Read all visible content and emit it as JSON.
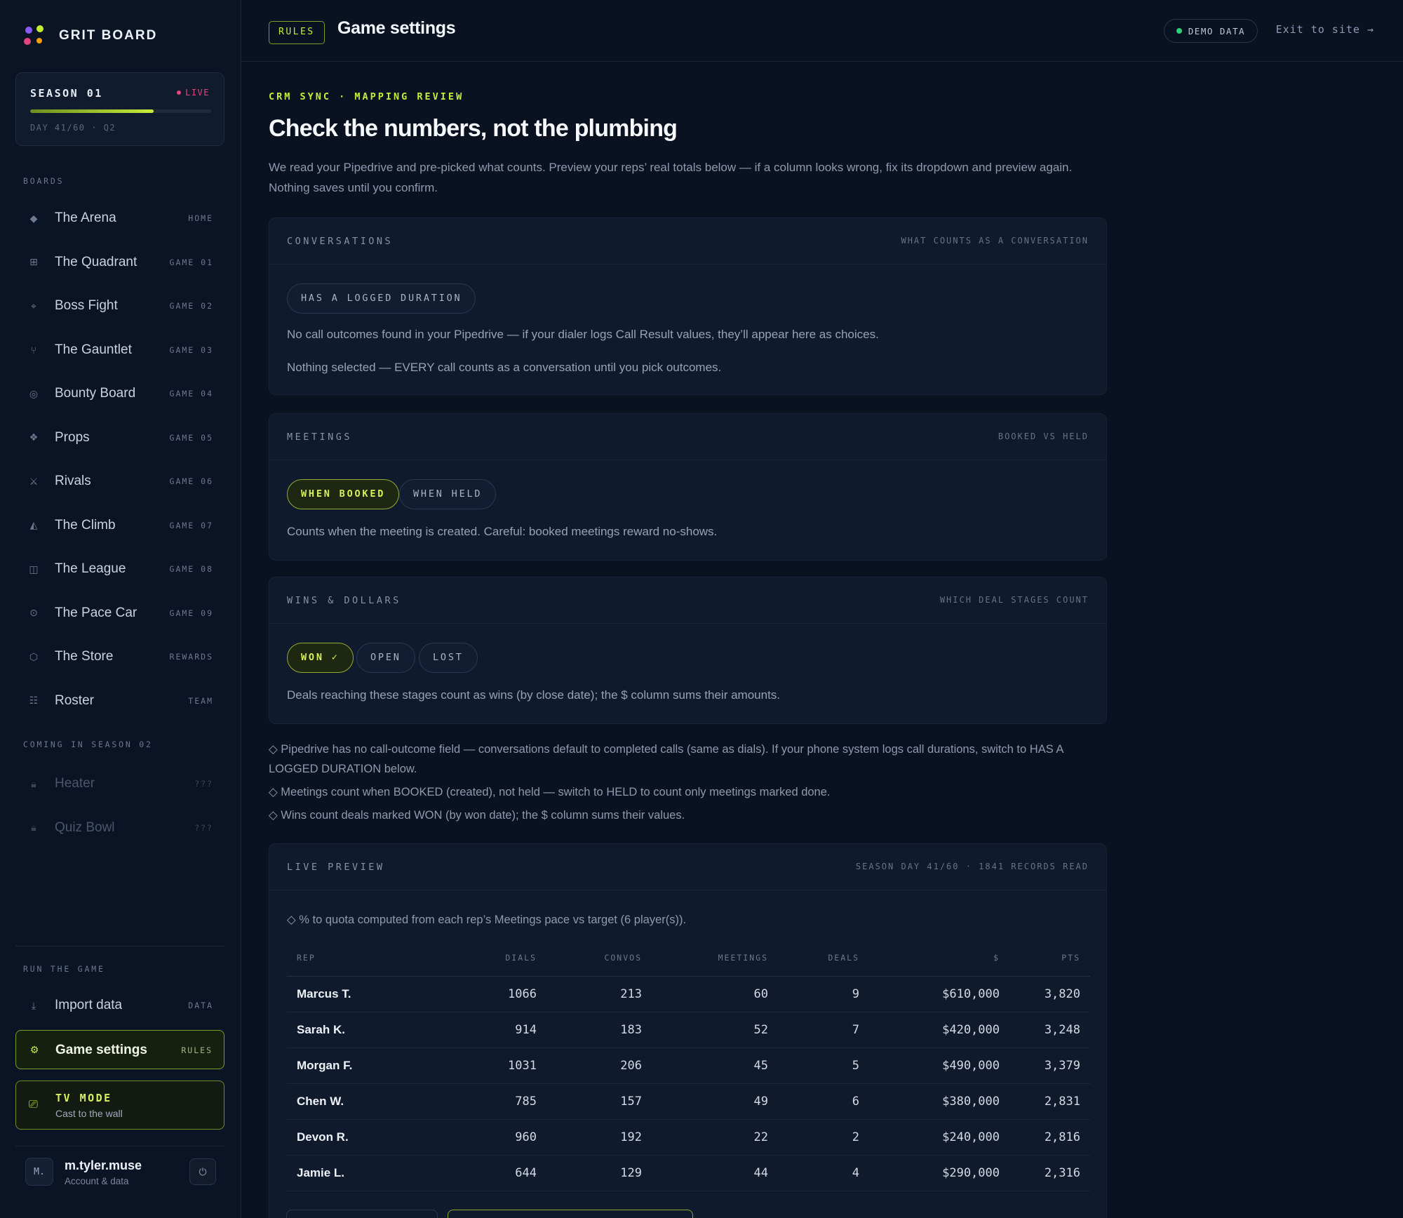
{
  "brand": {
    "name": "GRIT BOARD",
    "colors": [
      "#8a5cf6",
      "#c6ec3a",
      "#e5457d",
      "#f59e0b"
    ]
  },
  "season": {
    "title": "SEASON 01",
    "status": "LIVE",
    "progress": 0.6833,
    "day": "DAY 41/60 · Q2"
  },
  "sidebar": {
    "boards_label": "BOARDS",
    "boards": [
      {
        "icon": "diamond-icon",
        "glyph": "◆",
        "label": "The Arena",
        "tag": "HOME"
      },
      {
        "icon": "grid-icon",
        "glyph": "⊞",
        "label": "The Quadrant",
        "tag": "GAME 01"
      },
      {
        "icon": "crosshair-icon",
        "glyph": "⌖",
        "label": "Boss Fight",
        "tag": "GAME 02"
      },
      {
        "icon": "fork-icon",
        "glyph": "⑂",
        "label": "The Gauntlet",
        "tag": "GAME 03"
      },
      {
        "icon": "target-icon",
        "glyph": "◎",
        "label": "Bounty Board",
        "tag": "GAME 04"
      },
      {
        "icon": "sparkle-icon",
        "glyph": "❖",
        "label": "Props",
        "tag": "GAME 05"
      },
      {
        "icon": "swords-icon",
        "glyph": "⚔",
        "label": "Rivals",
        "tag": "GAME 06"
      },
      {
        "icon": "mountain-icon",
        "glyph": "◭",
        "label": "The Climb",
        "tag": "GAME 07"
      },
      {
        "icon": "columns-icon",
        "glyph": "◫",
        "label": "The League",
        "tag": "GAME 08"
      },
      {
        "icon": "gauge-icon",
        "glyph": "⊙",
        "label": "The Pace Car",
        "tag": "GAME 09"
      },
      {
        "icon": "hexagon-icon",
        "glyph": "⬡",
        "label": "The Store",
        "tag": "REWARDS"
      },
      {
        "icon": "list-icon",
        "glyph": "☷",
        "label": "Roster",
        "tag": "TEAM"
      }
    ],
    "coming_label": "COMING IN SEASON 02",
    "coming": [
      {
        "icon": "lock-icon",
        "glyph": "🔒︎",
        "label": "Heater",
        "tag": "???"
      },
      {
        "icon": "lock-icon",
        "glyph": "🔒︎",
        "label": "Quiz Bowl",
        "tag": "???"
      }
    ],
    "run_label": "RUN THE GAME",
    "run": [
      {
        "icon": "download-icon",
        "glyph": "⤓",
        "label": "Import data",
        "tag": "DATA"
      },
      {
        "icon": "gear-icon",
        "glyph": "⚙",
        "label": "Game settings",
        "tag": "RULES"
      }
    ],
    "tv": {
      "title": "TV MODE",
      "subtitle": "Cast to the wall",
      "glyph": "⎚"
    },
    "user": {
      "initials": "M.",
      "name": "m.tyler.muse",
      "subtitle": "Account & data",
      "power_glyph": "⏻"
    }
  },
  "topbar": {
    "badge": "RULES",
    "title": "Game settings",
    "demo": "DEMO DATA",
    "exit": "Exit to site →",
    "demo_color": "#2fd07a",
    "accent": "#c6ec3a"
  },
  "main": {
    "kicker": "CRM SYNC · MAPPING REVIEW",
    "headline": "Check the numbers, not the plumbing",
    "lede": "We read your Pipedrive and pre-picked what counts. Preview your reps’ real totals below — if a column looks wrong, fix its dropdown and preview again. Nothing saves until you confirm.",
    "conversations": {
      "title": "CONVERSATIONS",
      "hint": "WHAT COUNTS AS A CONVERSATION",
      "chip": "HAS A LOGGED DURATION",
      "text1": "No call outcomes found in your Pipedrive — if your dialer logs Call Result values, they’ll appear here as choices.",
      "text2": "Nothing selected — EVERY call counts as a conversation until you pick outcomes."
    },
    "meetings": {
      "title": "MEETINGS",
      "hint": "BOOKED VS HELD",
      "chip_booked": "WHEN BOOKED",
      "chip_held": "WHEN HELD",
      "text": "Counts when the meeting is created. Careful: booked meetings reward no-shows."
    },
    "wins": {
      "title": "WINS & DOLLARS",
      "hint": "WHICH DEAL STAGES COUNT",
      "chip_won": "WON ✓",
      "chip_open": "OPEN",
      "chip_lost": "LOST",
      "text": "Deals reaching these stages count as wins (by close date); the $ column sums their amounts."
    },
    "notes": [
      "◇ Pipedrive has no call-outcome field — conversations default to completed calls (same as dials). If your phone system logs call durations, switch to HAS A LOGGED DURATION below.",
      "◇ Meetings count when BOOKED (created), not held — switch to HELD to count only meetings marked done.",
      "◇ Wins count deals marked WON (by won date); the $ column sums their values."
    ],
    "preview": {
      "title": "LIVE PREVIEW",
      "hint": "SEASON DAY 41/60 · 1841 RECORDS READ",
      "note": "◇ % to quota computed from each rep’s Meetings pace vs target (6 player(s)).",
      "columns": [
        "REP",
        "DIALS",
        "CONVOS",
        "MEETINGS",
        "DEALS",
        "$",
        "PTS"
      ],
      "rows": [
        [
          "Marcus T.",
          "1066",
          "213",
          "60",
          "9",
          "$610,000",
          "3,820"
        ],
        [
          "Sarah K.",
          "914",
          "183",
          "52",
          "7",
          "$420,000",
          "3,248"
        ],
        [
          "Morgan F.",
          "1031",
          "206",
          "45",
          "5",
          "$490,000",
          "3,379"
        ],
        [
          "Chen W.",
          "785",
          "157",
          "49",
          "6",
          "$380,000",
          "2,831"
        ],
        [
          "Devon R.",
          "960",
          "192",
          "22",
          "2",
          "$240,000",
          "2,816"
        ],
        [
          "Jamie L.",
          "644",
          "129",
          "44",
          "4",
          "$290,000",
          "2,316"
        ]
      ]
    }
  }
}
